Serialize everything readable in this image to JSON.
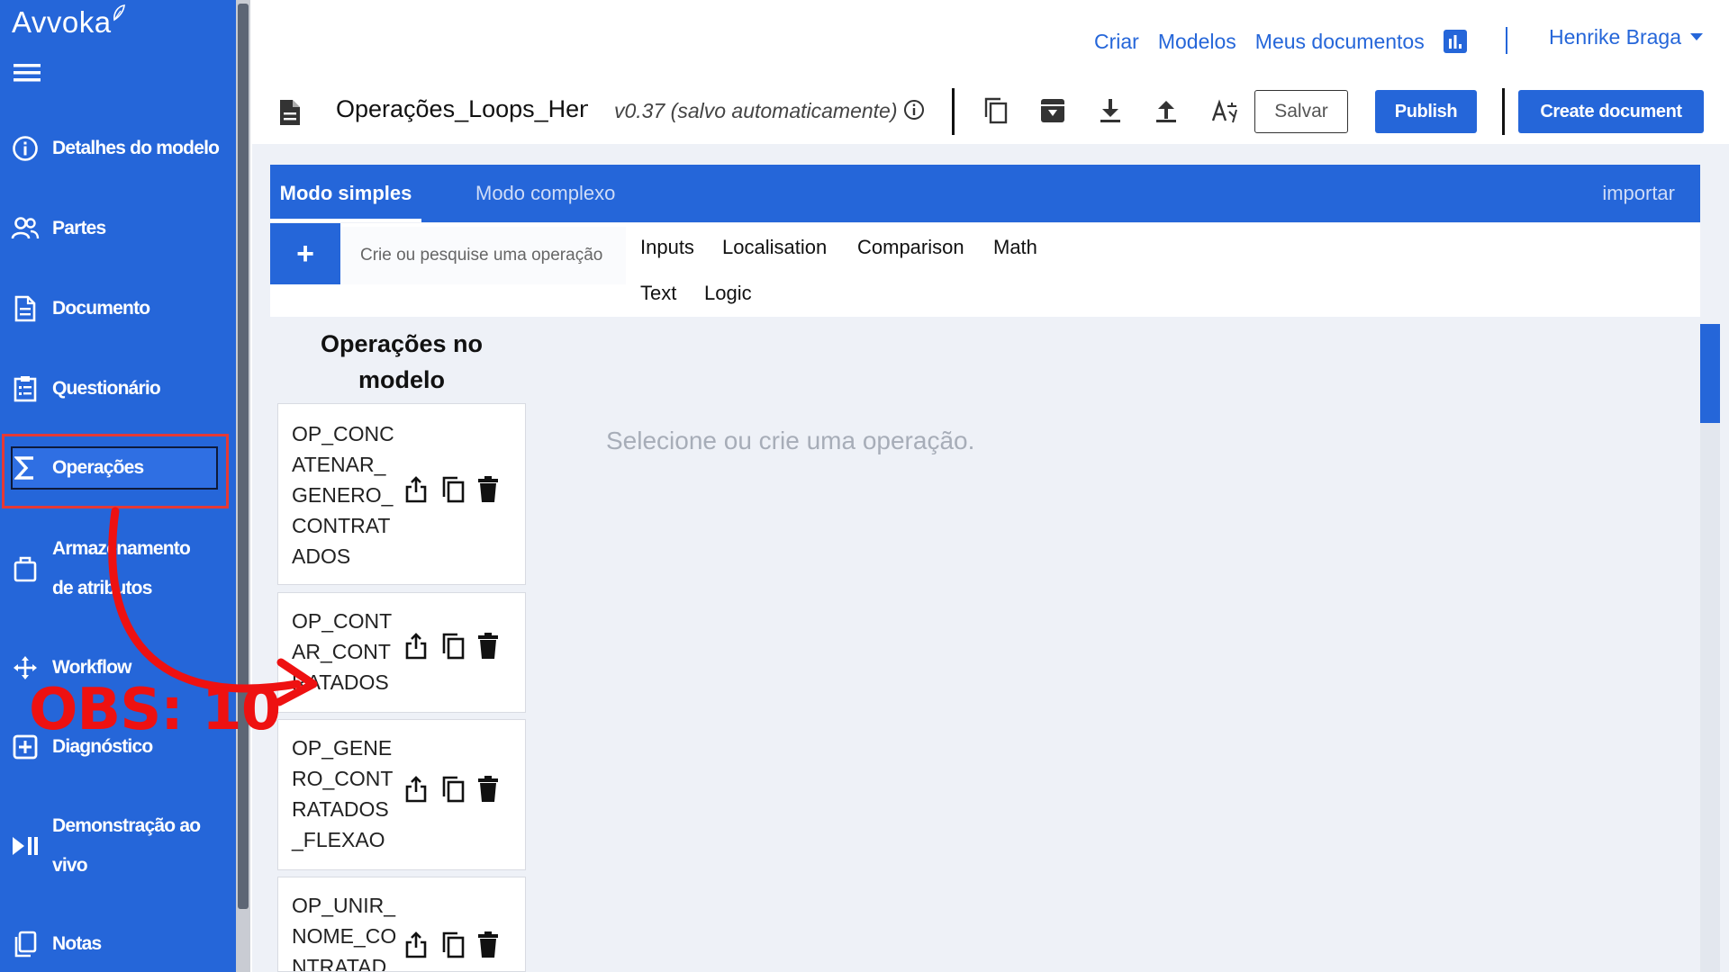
{
  "brand": "Avvoka",
  "sidebar": {
    "items": [
      {
        "label": "Detalhes do modelo",
        "icon": "info-circle-icon"
      },
      {
        "label": "Partes",
        "icon": "users-icon"
      },
      {
        "label": "Documento",
        "icon": "document-icon"
      },
      {
        "label": "Questionário",
        "icon": "clipboard-icon"
      },
      {
        "label": "Operações",
        "icon": "sigma-icon",
        "active": true
      },
      {
        "label": "Armazenamento de atributos",
        "icon": "clipboard-bag-icon"
      },
      {
        "label": "Workflow",
        "icon": "move-arrows-icon"
      },
      {
        "label": "Diagnóstico",
        "icon": "plus-square-icon"
      },
      {
        "label": "Demonstração ao vivo",
        "icon": "play-pause-icon"
      },
      {
        "label": "Notas",
        "icon": "copy-icon"
      }
    ]
  },
  "header": {
    "links": [
      "Criar",
      "Modelos",
      "Meus documentos"
    ],
    "user_name": "Henrike Braga"
  },
  "toolbar": {
    "doc_title": "Operações_Loops_Henrike",
    "version": "v0.37 (salvo automaticamente)",
    "save_label": "Salvar",
    "publish_label": "Publish",
    "create_label": "Create document"
  },
  "tabs": {
    "simple": "Modo simples",
    "complex": "Modo complexo",
    "import": "importar"
  },
  "search": {
    "placeholder": "Crie ou pesquise uma operação",
    "add_label": "+"
  },
  "categories": [
    "Inputs",
    "Localisation",
    "Comparison",
    "Math",
    "Text",
    "Logic"
  ],
  "operations": {
    "heading": "Operações no modelo",
    "items": [
      "OP_CONCATENAR_GENERO_CONTRATADOS",
      "OP_CONTAR_CONTRATADOS",
      "OP_GENERO_CONTRATADOS_FLEXAO",
      "OP_UNIR_NOME_CONTRATADOS"
    ]
  },
  "empty_state": "Selecione ou crie uma operação.",
  "annotation": {
    "label": "OBS: 10",
    "color": "#ee1111"
  },
  "colors": {
    "primary": "#2566d9",
    "highlight": "#e53935"
  }
}
